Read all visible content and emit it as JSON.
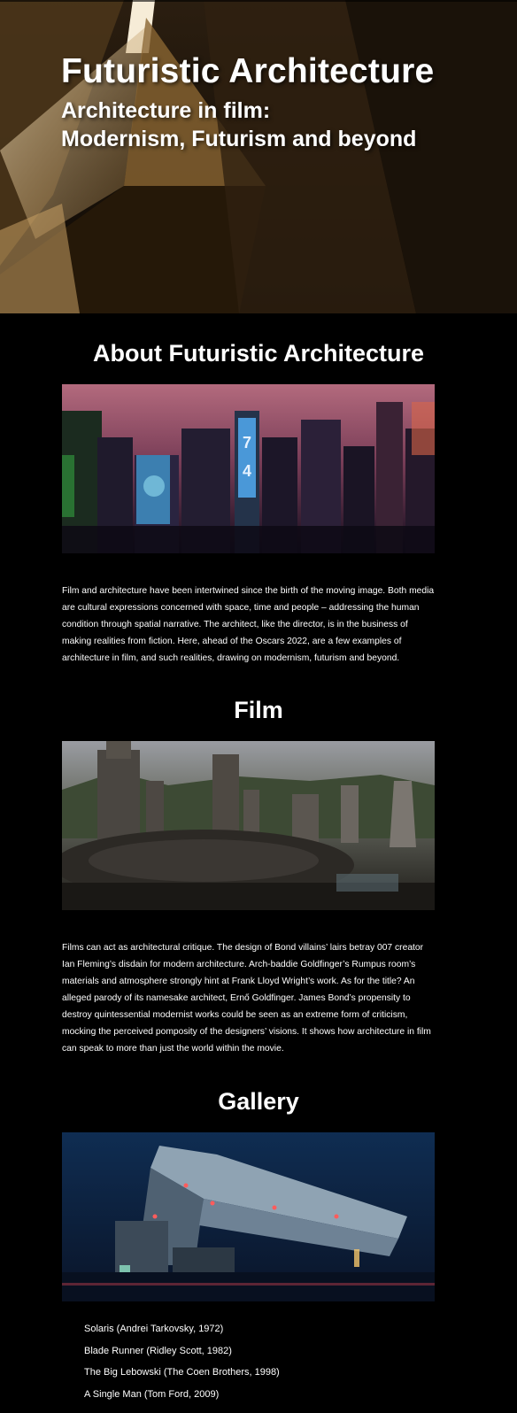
{
  "hero": {
    "title": "Futuristic Architecture",
    "subtitle_line1": "Architecture in film:",
    "subtitle_line2": "Modernism, Futurism and beyond"
  },
  "about": {
    "heading": "About Futuristic Architecture",
    "image_label": "cyberpunk-city-image",
    "billboard_text": "7 4",
    "paragraph": "Film and architecture have been intertwined since the birth of the moving image. Both media are cultural expressions concerned with space, time and people – addressing the human condition through spatial narrative. The architect, like the director, is in the business of making realities from fiction. Here, ahead of the Oscars 2022, are a few examples of architecture in film, and such realities, drawing on modernism, futurism and beyond."
  },
  "film": {
    "heading": "Film",
    "image_label": "futuristic-landscape-city-image",
    "paragraph": "Films can act as architectural critique. The design of Bond villains’ lairs betray 007 creator Ian Fleming’s disdain for modern architecture. Arch-baddie Goldfinger’s Rumpus room’s materials and atmosphere strongly hint at Frank Lloyd Wright’s work. As for the title? An alleged parody of its namesake architect, Ernő Goldfinger. James Bond’s propensity to destroy quintessential modernist works could be seen as an extreme form of criticism, mocking the perceived pomposity of the designers’ visions. It shows how architecture in film can speak to more than just the world within the movie."
  },
  "gallery": {
    "heading": "Gallery",
    "image_label": "night-building-image",
    "items": [
      "Solaris (Andrei Tarkovsky, 1972)",
      "Blade Runner (Ridley Scott, 1982)",
      "The Big Lebowski (The Coen Brothers, 1998)",
      "A Single Man (Tom Ford, 2009)"
    ]
  },
  "colors": {
    "background": "#000000",
    "text": "#ffffff",
    "hero_accent": "#c89a52"
  }
}
